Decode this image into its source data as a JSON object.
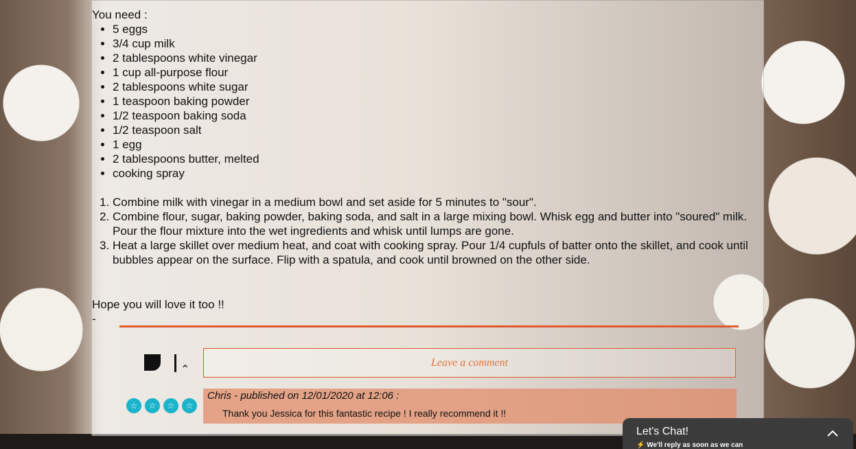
{
  "recipe": {
    "intro": "You need :",
    "ingredients": [
      "5 eggs",
      "3/4 cup milk",
      "2 tablespoons white vinegar",
      "1 cup all-purpose flour",
      "2 tablespoons white sugar",
      "1 teaspoon baking powder",
      "1/2 teaspoon baking soda",
      "1/2 teaspoon salt",
      "1 egg",
      "2 tablespoons butter, melted",
      "cooking spray"
    ],
    "steps": [
      "Combine milk with vinegar in a medium bowl and set aside for 5 minutes to \"sour\".",
      "Combine flour, sugar, baking powder, baking soda, and salt in a large mixing bowl. Whisk egg and butter into \"soured\" milk. Pour the flour mixture into the wet ingredients and whisk until lumps are gone.",
      "Heat a large skillet over medium heat, and coat with cooking spray. Pour 1/4 cupfuls of batter onto the skillet, and cook until bubbles appear on the surface. Flip with a spatula, and cook until browned on the other side."
    ],
    "outro": "Hope you will love it too !!",
    "dash": "-"
  },
  "comments": {
    "placeholder": "Leave a comment",
    "rating_icons": [
      "star-icon",
      "star-icon",
      "star-icon",
      "star-icon"
    ],
    "items": [
      {
        "meta": "Chris - published on 12/01/2020 at 12:06 :",
        "text": "Thank you Jessica for this fantastic recipe ! I really recommend it !!"
      }
    ]
  },
  "chat": {
    "title": "Let's Chat!",
    "subtitle": "We'll reply as soon as we can",
    "toggle_icon": "chevron-up-icon"
  },
  "colors": {
    "accent": "#e05a2b",
    "star": "#1bb3c9",
    "chat_bg": "#3b3b3b"
  }
}
